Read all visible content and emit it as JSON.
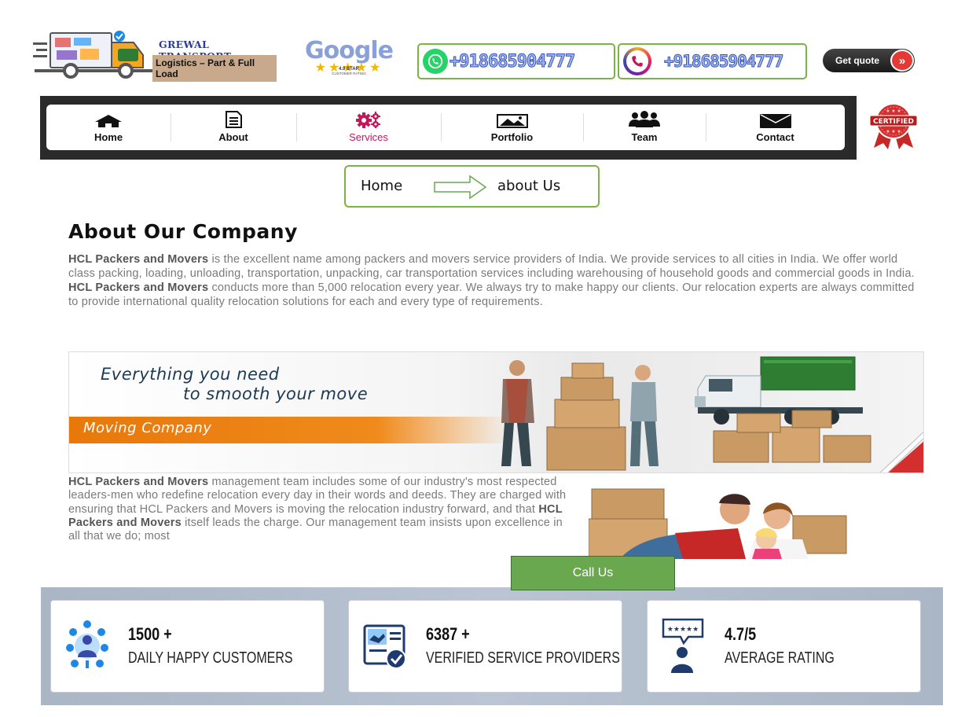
{
  "header": {
    "logo": {
      "brand": "GREWAL TRANSPORT",
      "tagline": "Logistics – Part & Full Load",
      "emblem": "GT"
    },
    "google_badge": {
      "word": "Google",
      "rating": "4.9 STAR",
      "subtitle": "CUSTOMER RATING"
    },
    "whatsapp": {
      "icon": "whatsapp-icon",
      "number": "+918685904777"
    },
    "phone": {
      "icon": "phone-icon",
      "number": "+918685904777"
    },
    "get_quote": {
      "label": "Get quote",
      "chevron": "»"
    }
  },
  "nav": {
    "items": [
      {
        "label": "Home",
        "icon": "home-icon"
      },
      {
        "label": "About",
        "icon": "document-icon"
      },
      {
        "label": "Services",
        "icon": "gears-icon",
        "active": true
      },
      {
        "label": "Portfolio",
        "icon": "image-icon"
      },
      {
        "label": "Team",
        "icon": "users-icon"
      },
      {
        "label": "Contact",
        "icon": "envelope-icon"
      }
    ],
    "certified_badge": "CERTIFIED"
  },
  "breadcrumb": {
    "home": "Home",
    "current": "about Us"
  },
  "about": {
    "title": "About Our Company",
    "intro": {
      "brand1": "HCL Packers and Movers",
      "text1": " is the excellent name among packers and movers service providers of India. We provide services to all cities in India. We offer world class packing, loading, unloading, transportation, unpacking, car transportation services including warehousing of household goods and commercial goods in India. ",
      "brand2": "HCL Packers and Movers",
      "text2": " conducts more than 5,000 relocation every year. We always try to make happy our clients. Our relocation experts are always committed to provide international quality relocation solutions for each and every type of requirements."
    },
    "banner": {
      "line1": "Everything you need",
      "line2": "to smooth your move",
      "ribbon": "Moving Company"
    },
    "management": {
      "brand1": "HCL Packers and Movers",
      "text1": " management team includes some of our industry's most respected leaders-men who redefine relocation every day in their words and deeds. They are charged with ensuring that HCL Packers and Movers is moving the relocation industry forward, and that ",
      "brand2": "HCL Packers and Movers",
      "text2": " itself leads the charge. Our management team insists upon excellence in all that we do; most"
    }
  },
  "call_us": {
    "label": "Call Us"
  },
  "stats": [
    {
      "value": "1500 +",
      "label": "DAILY HAPPY CUSTOMERS",
      "icon": "customers-icon"
    },
    {
      "value": "6387 +",
      "label": "VERIFIED SERVICE PROVIDERS",
      "icon": "verified-handshake-icon"
    },
    {
      "value": "4.7/5",
      "label": "AVERAGE RATING",
      "icon": "rating-icon",
      "stars": "★★★★★"
    }
  ],
  "colors": {
    "accent_green": "#7cb342",
    "call_us_green": "#6aa84f",
    "nav_active": "#c2185b",
    "quote_red": "#e53935",
    "banner_orange": "#e8780a"
  }
}
